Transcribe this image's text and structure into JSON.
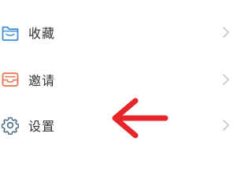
{
  "menu": {
    "items": [
      {
        "label": "收藏",
        "icon": "folder-icon",
        "icon_color": "#3a8fd6"
      },
      {
        "label": "邀请",
        "icon": "inbox-icon",
        "icon_color": "#e8744f"
      },
      {
        "label": "设置",
        "icon": "gear-icon",
        "icon_color": "#4a6a8a"
      }
    ],
    "chevron_icon": "chevron-right-icon",
    "chevron_color": "#c8c8c8"
  },
  "annotation": {
    "icon": "arrow-left-icon",
    "color": "#e8252a"
  }
}
